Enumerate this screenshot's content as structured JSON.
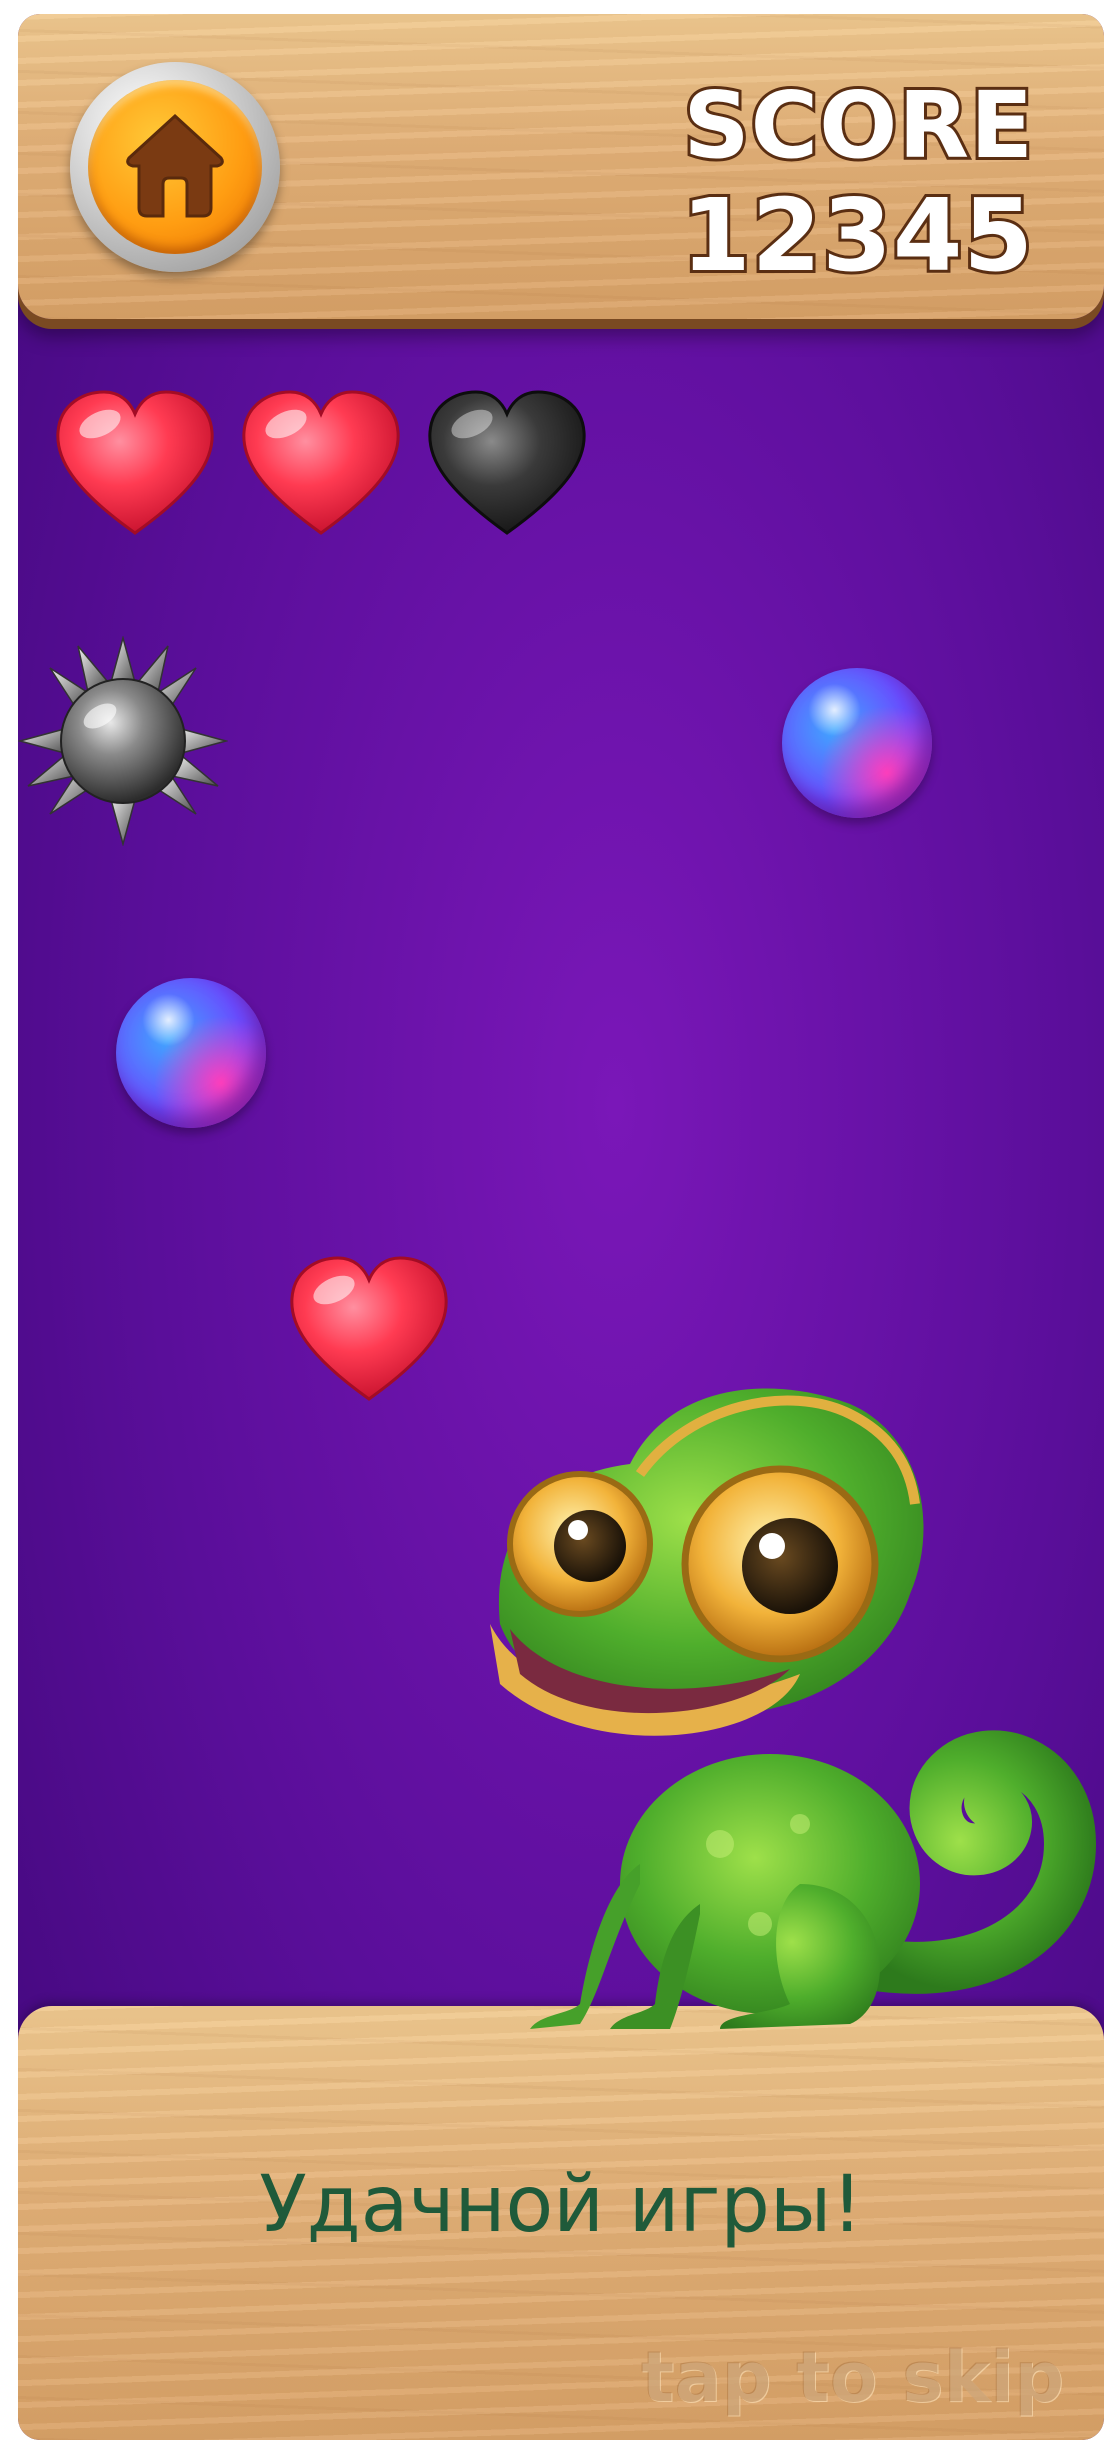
{
  "header": {
    "score_label": "SCORE",
    "score_value": "12345",
    "home_icon": "home-icon"
  },
  "lives": [
    {
      "state": "full",
      "color": "#ff3b52"
    },
    {
      "state": "full",
      "color": "#ff3b52"
    },
    {
      "state": "empty",
      "color": "#2b2b2b"
    }
  ],
  "items": [
    {
      "type": "spiked-mine"
    },
    {
      "type": "bubble-orb"
    },
    {
      "type": "bubble-orb"
    },
    {
      "type": "heart",
      "color": "#ff3b52"
    }
  ],
  "character": "chameleon",
  "footer": {
    "message": "Удачной игры!",
    "skip": "tap to skip"
  }
}
